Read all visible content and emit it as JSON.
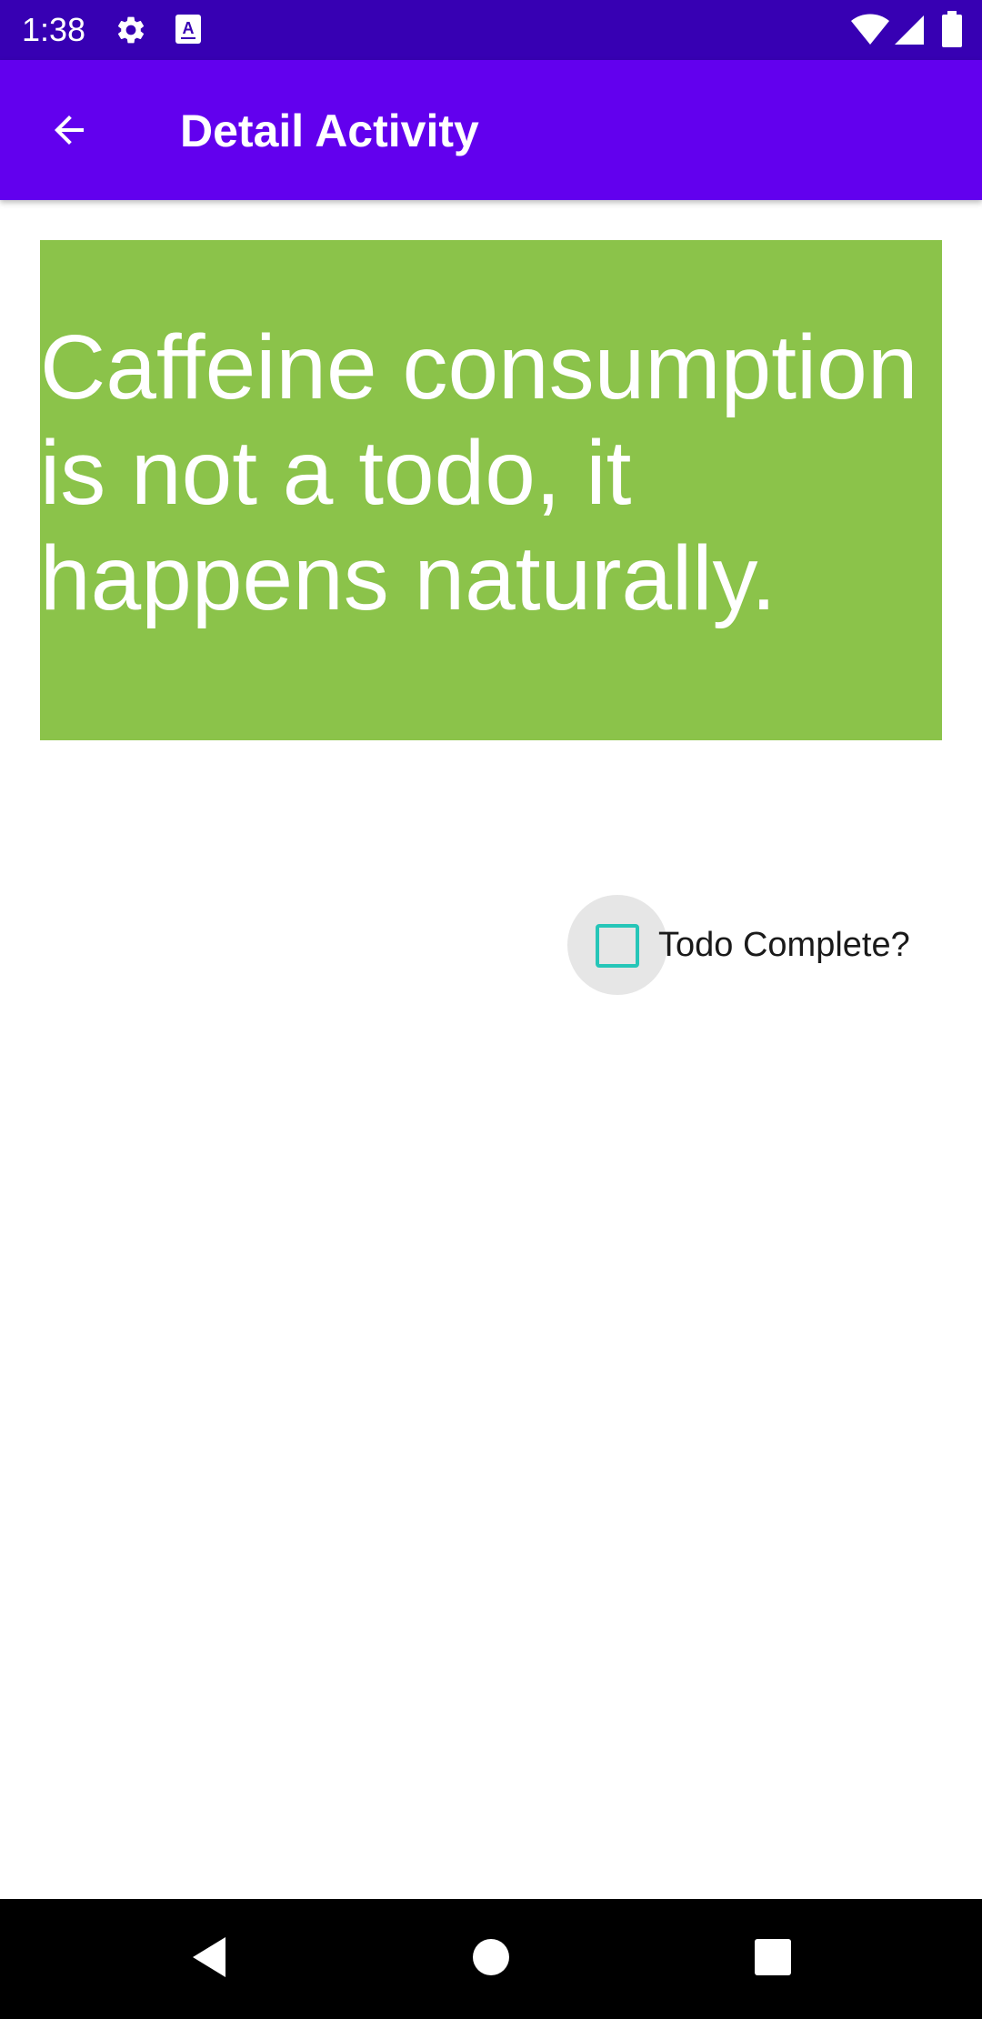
{
  "status_bar": {
    "time": "1:38",
    "icons": [
      "gear-icon",
      "a-icon",
      "wifi-icon",
      "signal-icon",
      "battery-icon"
    ],
    "background": "#3700b3"
  },
  "app_bar": {
    "title": "Detail Activity",
    "back_icon": "arrow-left-icon",
    "background": "#6200ee"
  },
  "todo": {
    "text": "Caffeine consumption is not a todo, it happens naturally.",
    "card_color": "#8bc34a"
  },
  "checkbox": {
    "label": "Todo Complete?",
    "checked": false,
    "accent": "#26c6b8"
  },
  "nav_bar": {
    "buttons": [
      "back-icon",
      "home-icon",
      "recents-icon"
    ]
  }
}
